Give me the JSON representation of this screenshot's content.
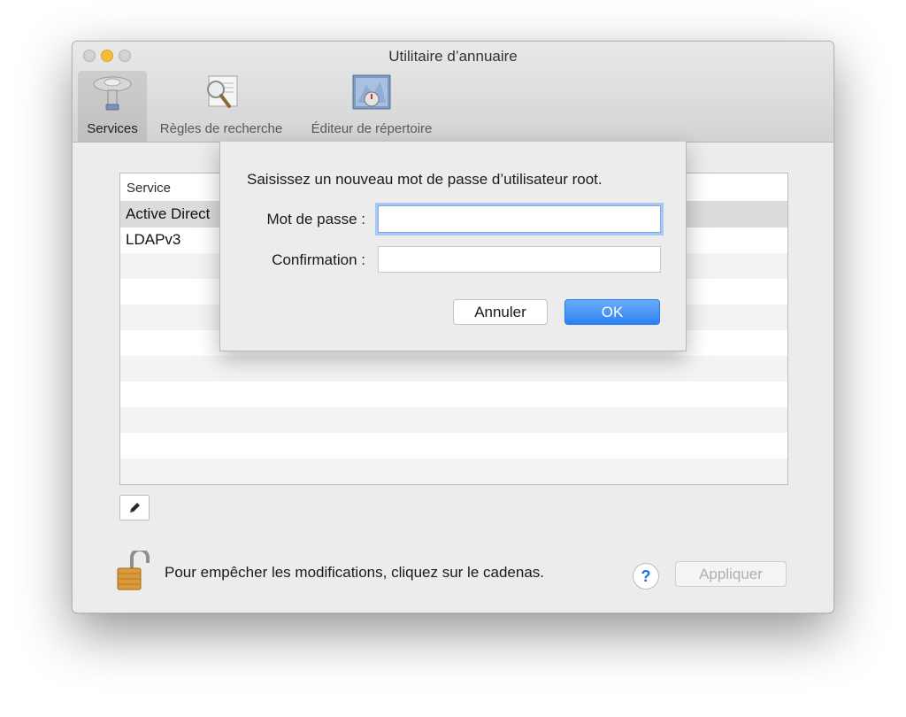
{
  "window": {
    "title": "Utilitaire d’annuaire"
  },
  "toolbar": {
    "items": [
      {
        "label": "Services",
        "icon": "services-icon",
        "selected": true
      },
      {
        "label": "Règles de recherche",
        "icon": "search-policy-icon",
        "selected": false
      },
      {
        "label": "Éditeur de répertoire",
        "icon": "directory-editor-icon",
        "selected": false
      }
    ]
  },
  "services_table": {
    "header": "Service",
    "rows": [
      "Active Direct",
      "LDAPv3"
    ]
  },
  "footer": {
    "lock_text": "Pour empêcher les modifications, cliquez sur le cadenas.",
    "help_label": "?",
    "apply_label": "Appliquer"
  },
  "password_sheet": {
    "message": "Saisissez un nouveau mot de passe d’utilisateur root.",
    "password_label": "Mot de passe :",
    "password_value": "",
    "confirm_label": "Confirmation :",
    "confirm_value": "",
    "cancel_label": "Annuler",
    "ok_label": "OK"
  },
  "colors": {
    "accent": "#3b8bf5",
    "focus_ring": "#a9c7f3",
    "lock": "#d89a3a"
  }
}
